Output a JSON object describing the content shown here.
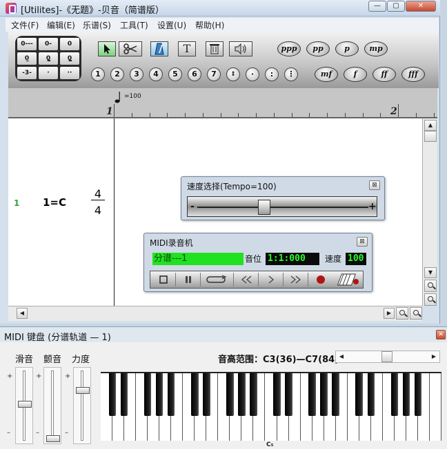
{
  "window": {
    "title": "[Utilites]-《无题》-贝音（简谱版）",
    "minimize": "—",
    "maximize": "▢",
    "close": "✕"
  },
  "menu": {
    "items": [
      "文件(F)",
      "编辑(E)",
      "乐谱(S)",
      "工具(T)",
      "设置(U)",
      "帮助(H)"
    ]
  },
  "toolbar": {
    "durations": [
      "0---",
      "0-",
      "0",
      "0̲",
      "0̳",
      "0̳̲",
      "-3-",
      "·",
      "··"
    ],
    "tools": [
      "select-tool",
      "scissors-tool",
      "metronome-tool",
      "text-tool",
      "trash-tool",
      "speaker-tool"
    ],
    "text_tool_label": "T",
    "numbers": [
      "1",
      "2",
      "3",
      "4",
      "5",
      "6",
      "7"
    ],
    "dynamics_top": [
      "ppp",
      "pp",
      "p",
      "mp"
    ],
    "dynamics_bottom": [
      "mf",
      "f",
      "ff",
      "fff"
    ]
  },
  "score": {
    "tempo": "=100",
    "measures": [
      "1",
      "2"
    ],
    "track_number": "1",
    "key": "1=C",
    "time_sig_top": "4",
    "time_sig_bottom": "4"
  },
  "tempo_dialog": {
    "title": "速度选择(Tempo=100)",
    "minus": "-",
    "plus": "+",
    "value_fraction": 0.39
  },
  "recorder": {
    "title": "MIDI录音机",
    "track_name": "分谱---1",
    "position_label": "音位",
    "position": "1:1:000",
    "speed_label": "速度",
    "speed": "100"
  },
  "keyboard": {
    "title": "MIDI 键盘 (分谱轨道 — 1)",
    "slide_label": "滑音",
    "tremolo_label": "颤音",
    "velocity_label": "力度",
    "plus": "+",
    "minus": "–",
    "range_label": "音高范围：C3(36)—C7(84)",
    "c_marker": "C₅"
  },
  "colors": {
    "lcd_green": "#21e121",
    "lcd_dark": "#0b0b0b",
    "track_green": "#37a037"
  }
}
